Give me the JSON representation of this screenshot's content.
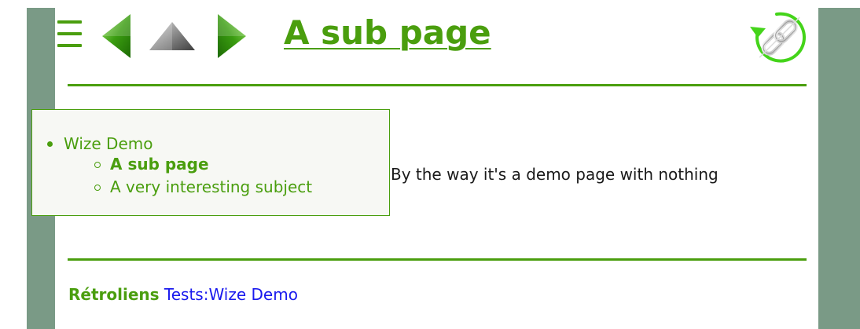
{
  "header": {
    "title": "A sub page",
    "icons": {
      "menu": "hamburger-menu-icon",
      "previous": "previous-page-arrow-icon",
      "parent": "parent-page-arrow-icon",
      "next": "next-page-arrow-icon",
      "links": "link-chain-icon"
    }
  },
  "nav_tree": {
    "root": {
      "label": "Wize Demo"
    },
    "children": [
      {
        "label": "A sub page",
        "current": true
      },
      {
        "label": "A very interesting subject",
        "current": false
      }
    ]
  },
  "main": {
    "paragraph": "By the way it's a demo page with nothing"
  },
  "footer": {
    "backlinks_label": "Rétroliens",
    "backlinks_link": "Tests:Wize Demo"
  },
  "colors": {
    "accent_green": "#4a9e0e",
    "side_band": "#7a9a86",
    "link_blue": "#1a1aee",
    "popup_background": "#f7f8f4",
    "text": "#1a1a1a"
  }
}
